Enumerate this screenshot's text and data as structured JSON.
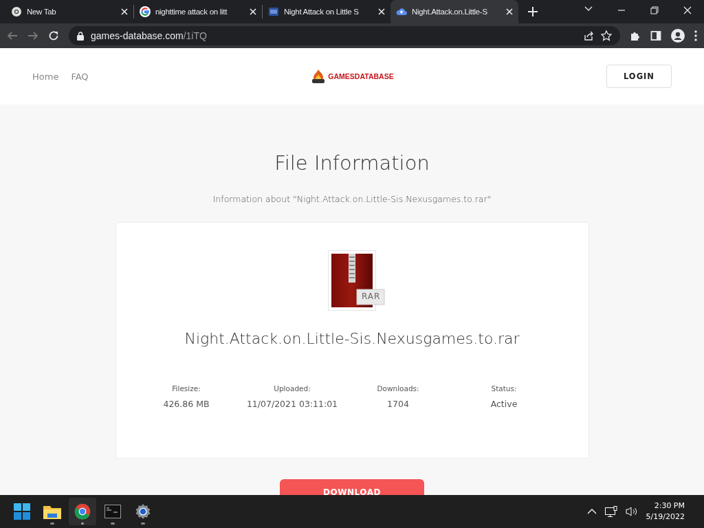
{
  "browser": {
    "tabs": [
      {
        "kind": "chrome",
        "title": "New Tab",
        "selected": false
      },
      {
        "kind": "google",
        "title": "nighttime attack on litt",
        "selected": false
      },
      {
        "kind": "ng",
        "title": "Night Attack on Little S",
        "selected": false
      },
      {
        "kind": "cloud",
        "title": "Night.Attack.on.Little-S",
        "selected": true
      }
    ],
    "address": {
      "domain": "games-database.com",
      "path": "/1iTQ"
    }
  },
  "site": {
    "nav": [
      "Home",
      "FAQ"
    ],
    "logo": "GAMESDATABASE",
    "login": "LOGIN"
  },
  "file": {
    "heading": "File Information",
    "subtitle": "Information about \"Night.Attack.on.Little-Sis.Nexusgames.to.rar\"",
    "badge": "RAR",
    "name": "Night.Attack.on.Little-Sis.Nexusgames.to.rar",
    "stats": [
      {
        "label": "Filesize:",
        "value": "426.86 MB"
      },
      {
        "label": "Uploaded:",
        "value": "11/07/2021 03:11:01"
      },
      {
        "label": "Downloads:",
        "value": "1704"
      },
      {
        "label": "Status:",
        "value": "Active"
      }
    ],
    "download": "DOWNLOAD"
  },
  "taskbar": {
    "apps": [
      {
        "kind": "start",
        "selected": false
      },
      {
        "kind": "explorer",
        "selected": false
      },
      {
        "kind": "chrome",
        "selected": true
      },
      {
        "kind": "terminal",
        "selected": false
      },
      {
        "kind": "settings",
        "selected": false
      }
    ],
    "time": "2:30 PM",
    "date": "5/19/2022"
  }
}
